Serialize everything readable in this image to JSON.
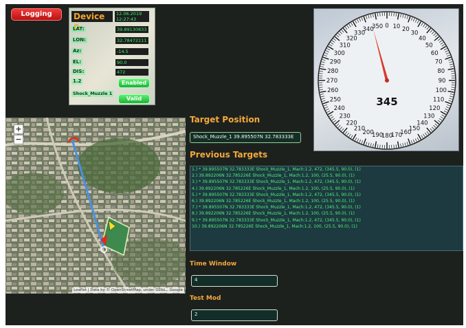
{
  "logging_button": "Logging",
  "device": {
    "title": "Device 0",
    "date": "12.06.2019",
    "time": "12:27:43",
    "fields": [
      {
        "label": "LAT:",
        "value": "39.89130833"
      },
      {
        "label": "LON:",
        "value": "32.78472111"
      },
      {
        "label": "Az:",
        "value": "-14.5"
      },
      {
        "label": "EL:",
        "value": "90.0"
      },
      {
        "label": "DIS:",
        "value": "472"
      },
      {
        "label": "1.2",
        "value": ""
      }
    ],
    "enabled_button": "Enabled",
    "target_label": "Shock_Muzzle 1",
    "valid_button": "Valid"
  },
  "compass": {
    "heading_value": "345",
    "heading_deg": 345,
    "labels": [
      "0",
      "10",
      "20",
      "30",
      "40",
      "50",
      "60",
      "70",
      "80",
      "90",
      "100",
      "110",
      "120",
      "130",
      "140",
      "150",
      "160",
      "170",
      "180",
      "190",
      "200",
      "210",
      "220",
      "230",
      "240",
      "250",
      "260",
      "270",
      "280",
      "290",
      "300",
      "310",
      "320",
      "330",
      "340",
      "350"
    ]
  },
  "map": {
    "zoom_in": "+",
    "zoom_out": "−",
    "attribution": "Leaflet | Data by © OpenStreetMap, under ODbL., Google"
  },
  "target_position": {
    "heading": "Target Position",
    "value": "Shock_Muzzle_1 39.895507N  32.783333E"
  },
  "previous_targets": {
    "heading": "Previous Targets",
    "rows": [
      "1.) *  39.895507N  32.783333E Shock_Muzzle_1, Mach:1.2, 472, (345.5, 90.0), (1)",
      "2.)  39.892206N  32.785226E Shock_Muzzle_1, Mach:1.2, 100, (25.5, 90.0), (1)",
      "3.) *  39.895507N  32.783333E Shock_Muzzle_1, Mach:1.2, 472, (345.5, 90.0), (1)",
      "4.)  39.892206N  32.785226E Shock_Muzzle_1, Mach:1.2, 100, (25.5, 90.0), (1)",
      "5.) *  39.895507N  32.783333E Shock_Muzzle_1, Mach:1.2, 472, (345.5, 90.0), (1)",
      "6.)  39.892206N  32.785226E Shock_Muzzle_1, Mach:1.2, 100, (25.5, 90.0), (1)",
      "7.) *  39.895507N  32.783333E Shock_Muzzle_1, Mach:1.2, 472, (345.5, 90.0), (1)",
      "8.)  39.892206N  32.785226E Shock_Muzzle_1, Mach:1.2, 100, (25.5, 90.0), (1)",
      "9.) *  39.895507N  32.783333E Shock_Muzzle_1, Mach:1.2, 472, (345.5, 90.0), (1)",
      "10.)  39.892206N  32.785226E Shock_Muzzle_1, Mach:1.2, 100, (25.5, 90.0), (1)"
    ]
  },
  "time_window": {
    "label": "Time Window",
    "value": "4"
  },
  "test_mod": {
    "label": "Test Mod",
    "value": "2"
  },
  "colors": {
    "accent": "#f6a83a",
    "ok": "#3ef070",
    "alert": "#e52020"
  }
}
